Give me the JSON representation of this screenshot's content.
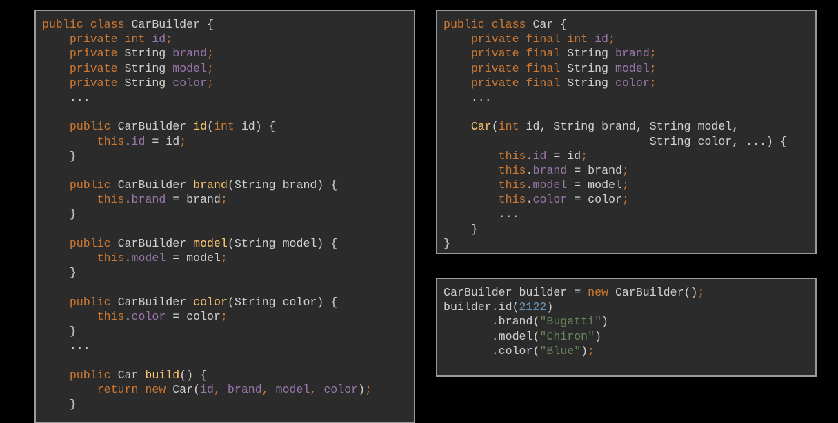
{
  "colors": {
    "background": "#000000",
    "panel": "#2b2b2b",
    "panel_border": "#9a9a9a",
    "keyword": "#cc7832",
    "field": "#9876aa",
    "method": "#ffc66d",
    "string": "#6a8759",
    "number": "#6897bb",
    "plain": "#cfcfcf"
  },
  "panels": [
    {
      "name": "carbuilder-class-panel",
      "lines": [
        [
          [
            "kw",
            "public class "
          ],
          [
            "txt",
            "CarBuilder {"
          ]
        ],
        [
          [
            "txt",
            "    "
          ],
          [
            "kw",
            "private int "
          ],
          [
            "fld",
            "id"
          ],
          [
            "kw",
            ";"
          ]
        ],
        [
          [
            "txt",
            "    "
          ],
          [
            "kw",
            "private "
          ],
          [
            "txt",
            "String "
          ],
          [
            "fld",
            "brand"
          ],
          [
            "kw",
            ";"
          ]
        ],
        [
          [
            "txt",
            "    "
          ],
          [
            "kw",
            "private "
          ],
          [
            "txt",
            "String "
          ],
          [
            "fld",
            "model"
          ],
          [
            "kw",
            ";"
          ]
        ],
        [
          [
            "txt",
            "    "
          ],
          [
            "kw",
            "private "
          ],
          [
            "txt",
            "String "
          ],
          [
            "fld",
            "color"
          ],
          [
            "kw",
            ";"
          ]
        ],
        [
          [
            "txt",
            "    ..."
          ]
        ],
        [],
        [
          [
            "txt",
            "    "
          ],
          [
            "kw",
            "public "
          ],
          [
            "txt",
            "CarBuilder "
          ],
          [
            "mth",
            "id"
          ],
          [
            "txt",
            "("
          ],
          [
            "kw",
            "int "
          ],
          [
            "txt",
            "id) {"
          ]
        ],
        [
          [
            "txt",
            "        "
          ],
          [
            "kw",
            "this"
          ],
          [
            "txt",
            "."
          ],
          [
            "fld",
            "id"
          ],
          [
            "txt",
            " = id"
          ],
          [
            "kw",
            ";"
          ]
        ],
        [
          [
            "txt",
            "    }"
          ]
        ],
        [],
        [
          [
            "txt",
            "    "
          ],
          [
            "kw",
            "public "
          ],
          [
            "txt",
            "CarBuilder "
          ],
          [
            "mth",
            "brand"
          ],
          [
            "txt",
            "(String brand) {"
          ]
        ],
        [
          [
            "txt",
            "        "
          ],
          [
            "kw",
            "this"
          ],
          [
            "txt",
            "."
          ],
          [
            "fld",
            "brand"
          ],
          [
            "txt",
            " = brand"
          ],
          [
            "kw",
            ";"
          ]
        ],
        [
          [
            "txt",
            "    }"
          ]
        ],
        [],
        [
          [
            "txt",
            "    "
          ],
          [
            "kw",
            "public "
          ],
          [
            "txt",
            "CarBuilder "
          ],
          [
            "mth",
            "model"
          ],
          [
            "txt",
            "(String model) {"
          ]
        ],
        [
          [
            "txt",
            "        "
          ],
          [
            "kw",
            "this"
          ],
          [
            "txt",
            "."
          ],
          [
            "fld",
            "model"
          ],
          [
            "txt",
            " = model"
          ],
          [
            "kw",
            ";"
          ]
        ],
        [
          [
            "txt",
            "    }"
          ]
        ],
        [],
        [
          [
            "txt",
            "    "
          ],
          [
            "kw",
            "public "
          ],
          [
            "txt",
            "CarBuilder "
          ],
          [
            "mth",
            "color"
          ],
          [
            "txt",
            "(String color) {"
          ]
        ],
        [
          [
            "txt",
            "        "
          ],
          [
            "kw",
            "this"
          ],
          [
            "txt",
            "."
          ],
          [
            "fld",
            "color"
          ],
          [
            "txt",
            " = color"
          ],
          [
            "kw",
            ";"
          ]
        ],
        [
          [
            "txt",
            "    }"
          ]
        ],
        [
          [
            "txt",
            "    ..."
          ]
        ],
        [],
        [
          [
            "txt",
            "    "
          ],
          [
            "kw",
            "public "
          ],
          [
            "txt",
            "Car "
          ],
          [
            "mth",
            "build"
          ],
          [
            "txt",
            "() {"
          ]
        ],
        [
          [
            "txt",
            "        "
          ],
          [
            "kw",
            "return new "
          ],
          [
            "txt",
            "Car("
          ],
          [
            "fld",
            "id"
          ],
          [
            "kw",
            ", "
          ],
          [
            "fld",
            "brand"
          ],
          [
            "kw",
            ", "
          ],
          [
            "fld",
            "model"
          ],
          [
            "kw",
            ", "
          ],
          [
            "fld",
            "color"
          ],
          [
            "txt",
            ")"
          ],
          [
            "kw",
            ";"
          ]
        ],
        [
          [
            "txt",
            "    }"
          ]
        ]
      ]
    },
    {
      "name": "car-class-panel",
      "lines": [
        [
          [
            "kw",
            "public class "
          ],
          [
            "txt",
            "Car {"
          ]
        ],
        [
          [
            "txt",
            "    "
          ],
          [
            "kw",
            "private final int "
          ],
          [
            "fld",
            "id"
          ],
          [
            "kw",
            ";"
          ]
        ],
        [
          [
            "txt",
            "    "
          ],
          [
            "kw",
            "private final "
          ],
          [
            "txt",
            "String "
          ],
          [
            "fld",
            "brand"
          ],
          [
            "kw",
            ";"
          ]
        ],
        [
          [
            "txt",
            "    "
          ],
          [
            "kw",
            "private final "
          ],
          [
            "txt",
            "String "
          ],
          [
            "fld",
            "model"
          ],
          [
            "kw",
            ";"
          ]
        ],
        [
          [
            "txt",
            "    "
          ],
          [
            "kw",
            "private final "
          ],
          [
            "txt",
            "String "
          ],
          [
            "fld",
            "color"
          ],
          [
            "kw",
            ";"
          ]
        ],
        [
          [
            "txt",
            "    ..."
          ]
        ],
        [],
        [
          [
            "txt",
            "    "
          ],
          [
            "mth",
            "Car"
          ],
          [
            "txt",
            "("
          ],
          [
            "kw",
            "int "
          ],
          [
            "txt",
            "id, String brand, String model,"
          ]
        ],
        [
          [
            "txt",
            "                              String color, ...) {"
          ]
        ],
        [
          [
            "txt",
            "        "
          ],
          [
            "kw",
            "this"
          ],
          [
            "txt",
            "."
          ],
          [
            "fld",
            "id"
          ],
          [
            "txt",
            " = id"
          ],
          [
            "kw",
            ";"
          ]
        ],
        [
          [
            "txt",
            "        "
          ],
          [
            "kw",
            "this"
          ],
          [
            "txt",
            "."
          ],
          [
            "fld",
            "brand"
          ],
          [
            "txt",
            " = brand"
          ],
          [
            "kw",
            ";"
          ]
        ],
        [
          [
            "txt",
            "        "
          ],
          [
            "kw",
            "this"
          ],
          [
            "txt",
            "."
          ],
          [
            "fld",
            "model"
          ],
          [
            "txt",
            " = model"
          ],
          [
            "kw",
            ";"
          ]
        ],
        [
          [
            "txt",
            "        "
          ],
          [
            "kw",
            "this"
          ],
          [
            "txt",
            "."
          ],
          [
            "fld",
            "color"
          ],
          [
            "txt",
            " = color"
          ],
          [
            "kw",
            ";"
          ]
        ],
        [
          [
            "txt",
            "        ..."
          ]
        ],
        [
          [
            "txt",
            "    }"
          ]
        ],
        [
          [
            "txt",
            "}"
          ]
        ]
      ]
    },
    {
      "name": "builder-usage-panel",
      "lines": [
        [
          [
            "txt",
            "CarBuilder builder = "
          ],
          [
            "kw",
            "new "
          ],
          [
            "txt",
            "CarBuilder()"
          ],
          [
            "kw",
            ";"
          ]
        ],
        [
          [
            "txt",
            "builder.id("
          ],
          [
            "num",
            "2122"
          ],
          [
            "txt",
            ")"
          ]
        ],
        [
          [
            "txt",
            "       .brand("
          ],
          [
            "str",
            "\"Bugatti\""
          ],
          [
            "txt",
            ")"
          ]
        ],
        [
          [
            "txt",
            "       .model("
          ],
          [
            "str",
            "\"Chiron\""
          ],
          [
            "txt",
            ")"
          ]
        ],
        [
          [
            "txt",
            "       .color("
          ],
          [
            "str",
            "\"Blue\""
          ],
          [
            "txt",
            ")"
          ],
          [
            "kw",
            ";"
          ]
        ]
      ]
    }
  ]
}
